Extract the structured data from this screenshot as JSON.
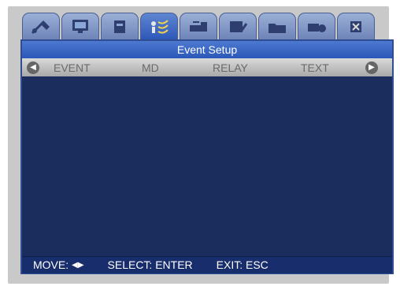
{
  "window": {
    "title": "Event Setup"
  },
  "tabs": [
    {
      "icon": "tools-icon"
    },
    {
      "icon": "monitor-icon"
    },
    {
      "icon": "hdd-icon"
    },
    {
      "icon": "event-icon",
      "active": true
    },
    {
      "icon": "network-icon"
    },
    {
      "icon": "settings-icon"
    },
    {
      "icon": "folder-icon"
    },
    {
      "icon": "backup-icon"
    },
    {
      "icon": "close-icon"
    }
  ],
  "columns": {
    "left_scroll": "◀",
    "headers": [
      "EVENT",
      "MD",
      "RELAY",
      "TEXT"
    ],
    "right_scroll": "▶"
  },
  "footer": {
    "move_label": "MOVE:",
    "move_arrows": "◀▶",
    "select_label": "SELECT: ENTER",
    "exit_label": "EXIT: ESC"
  }
}
